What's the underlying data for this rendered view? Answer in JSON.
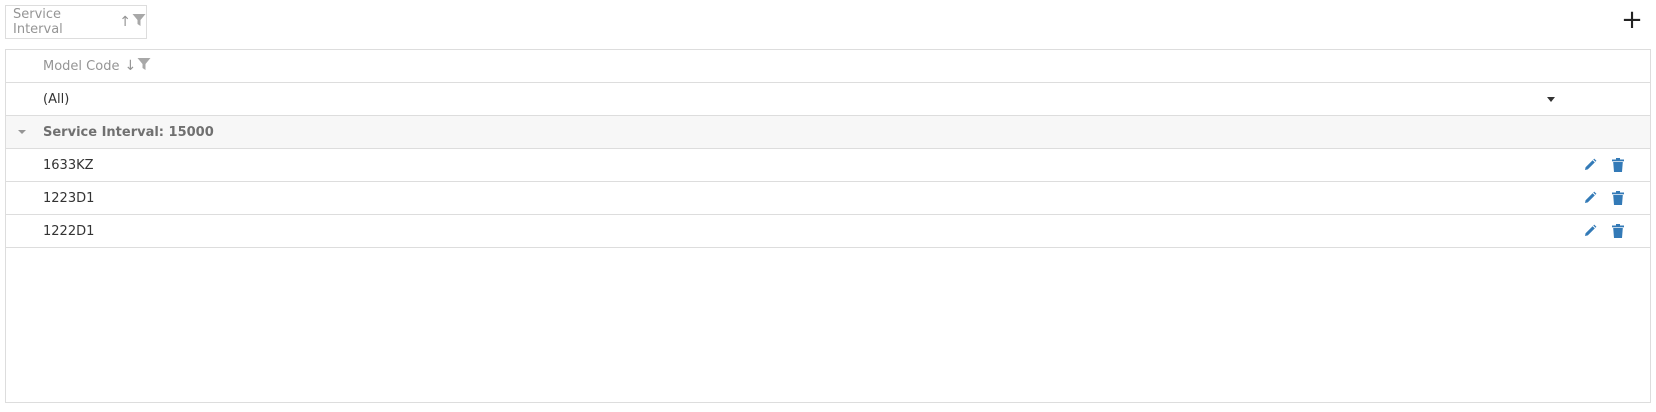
{
  "toolbar": {
    "group_chip_label": "Service Interval",
    "group_chip_sort": "↑",
    "add_label": "+"
  },
  "grid": {
    "header": {
      "column_label": "Model Code",
      "sort": "↓"
    },
    "filter": {
      "value": "(All)"
    },
    "group": {
      "label": "Service Interval: 15000"
    },
    "rows": [
      {
        "model_code": "1633KZ"
      },
      {
        "model_code": "1223D1"
      },
      {
        "model_code": "1222D1"
      }
    ]
  },
  "colors": {
    "accent": "#337ab7",
    "border": "#dddddd",
    "muted_text": "#959595",
    "group_bg": "#f7f7f7"
  },
  "icons": {
    "filter": "filter-icon",
    "edit": "pencil-icon",
    "delete": "trash-icon",
    "add": "plus-icon",
    "group_toggle": "caret-down-icon",
    "dropdown": "caret-down-icon"
  }
}
